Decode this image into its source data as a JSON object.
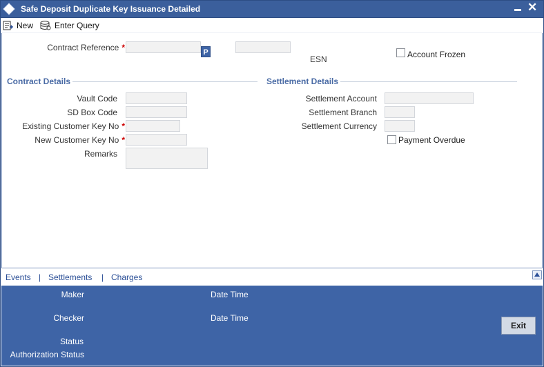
{
  "window": {
    "title": "Safe Deposit Duplicate Key Issuance Detailed"
  },
  "toolbar": {
    "new_label": "New",
    "enter_query_label": "Enter Query"
  },
  "header": {
    "contract_reference_label": "Contract Reference",
    "p_button_label": "P",
    "esn_label": "ESN",
    "account_frozen_label": "Account Frozen"
  },
  "contract_details": {
    "title": "Contract Details",
    "vault_code_label": "Vault Code",
    "sd_box_code_label": "SD Box Code",
    "existing_customer_key_no_label": "Existing Customer Key No",
    "new_customer_key_no_label": "New Customer Key No",
    "remarks_label": "Remarks"
  },
  "settlement_details": {
    "title": "Settlement Details",
    "settlement_account_label": "Settlement Account",
    "settlement_branch_label": "Settlement Branch",
    "settlement_currency_label": "Settlement Currency",
    "payment_overdue_label": "Payment Overdue"
  },
  "tabs": {
    "events": "Events",
    "settlements": "Settlements",
    "charges": "Charges",
    "separator": "|"
  },
  "footer": {
    "maker_label": "Maker",
    "date_time_label": "Date Time",
    "checker_label": "Checker",
    "status_label": "Status",
    "authorization_status_label": "Authorization Status",
    "exit_label": "Exit"
  },
  "colors": {
    "titlebar": "#3b5f9c",
    "footer": "#3e64a6",
    "section_title": "#4a6ba5",
    "required": "#cc0000"
  }
}
